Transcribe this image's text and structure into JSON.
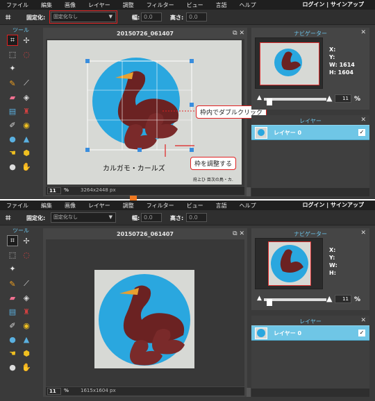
{
  "menu": {
    "items": [
      "ファイル",
      "編集",
      "画像",
      "レイヤー",
      "調整",
      "フィルター",
      "ビュー",
      "言語",
      "ヘルプ"
    ],
    "right": "ログイン | サインアップ"
  },
  "options": {
    "fixed_label": "固定化:",
    "fixed_value": "固定化なし",
    "width_label": "幅:",
    "width_value": "0.0",
    "height_label": "高さ:",
    "height_value": "0.0"
  },
  "tools": {
    "heading": "ツール",
    "icons": [
      "crop-icon",
      "move-icon",
      "marquee-icon",
      "lasso-icon",
      "magic-wand-icon",
      "pencil-icon",
      "brush-icon",
      "eraser-icon",
      "bucket-icon",
      "gradient-icon",
      "stamp-icon",
      "color-replace-icon",
      "red-eye-icon",
      "drop-icon",
      "sharpen-icon",
      "smudge-icon",
      "sponge-icon",
      "dodge-icon",
      "burn-icon",
      "text-icon",
      "eyedropper-icon",
      "hand-icon",
      "zoom-icon"
    ]
  },
  "top": {
    "document_title": "20150726_061407",
    "zoom": "11",
    "zoom_unit": "%",
    "dims": "3264x2448 px",
    "photo_caption": "カルガモ・カールズ",
    "photo_footer": "府上ひ 目次の鳥・カ.",
    "callout_double_click": "枠内でダブルクリック",
    "callout_adjust": "枠を調整する",
    "nav": {
      "title": "ナビゲーター",
      "x_label": "X:",
      "y_label": "Y:",
      "w_label": "W: 1614",
      "h_label": "H: 1604",
      "zoom": "11",
      "zoom_unit": "%"
    },
    "layers": {
      "title": "レイヤー",
      "layer_name": "レイヤー 0"
    }
  },
  "bottom": {
    "document_title": "20150726_061407",
    "zoom": "11",
    "zoom_unit": "%",
    "dims": "1615x1604 px",
    "nav": {
      "title": "ナビゲーター",
      "x_label": "X:",
      "y_label": "Y:",
      "w_label": "W:",
      "h_label": "H:",
      "zoom": "11",
      "zoom_unit": "%"
    },
    "layers": {
      "title": "レイヤー",
      "layer_name": "レイヤー 0"
    }
  },
  "colors": {
    "accent": "#6cc4ea",
    "callout_border": "#e02020",
    "arrow": "#f07820",
    "logo_blue": "#2aa7df"
  }
}
